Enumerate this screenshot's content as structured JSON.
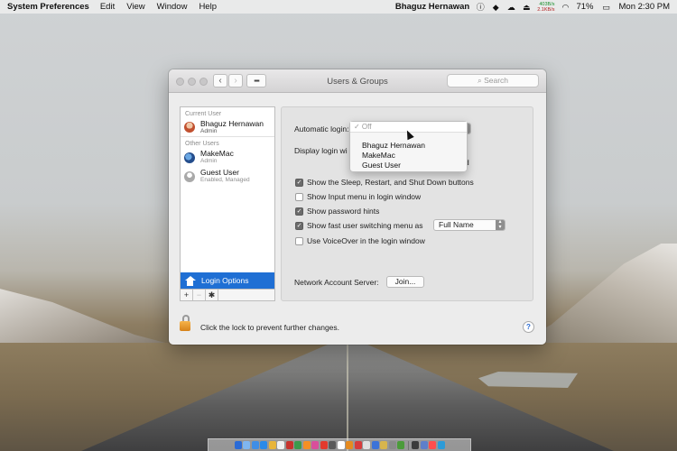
{
  "menubar": {
    "app_name": "System Preferences",
    "items": [
      "Edit",
      "View",
      "Window",
      "Help"
    ],
    "user_name": "Bhaguz Hernawan",
    "net_up": "403B/s",
    "net_down": "2.1KB/s",
    "battery": "71%",
    "clock": "Mon 2:30 PM"
  },
  "window": {
    "title": "Users & Groups",
    "search_placeholder": "Search"
  },
  "sidebar": {
    "current_user_header": "Current User",
    "other_users_header": "Other Users",
    "current_user": {
      "name": "Bhaguz Hernawan",
      "role": "Admin"
    },
    "other_users": [
      {
        "name": "MakeMac",
        "role": "Admin"
      },
      {
        "name": "Guest User",
        "role": "Enabled, Managed"
      }
    ],
    "login_options": "Login Options",
    "add": "+",
    "remove": "−",
    "gear": "✱"
  },
  "panel": {
    "automatic_login_label": "Automatic login:",
    "display_login_label": "Display login wi",
    "display_login_tail": "d",
    "checks": [
      {
        "label": "Show the Sleep, Restart, and Shut Down buttons",
        "checked": true
      },
      {
        "label": "Show Input menu in login window",
        "checked": false
      },
      {
        "label": "Show password hints",
        "checked": true
      },
      {
        "label": "Show fast user switching menu as",
        "checked": true
      },
      {
        "label": "Use VoiceOver in the login window",
        "checked": false
      }
    ],
    "fast_switch_value": "Full Name",
    "network_server_label": "Network Account Server:",
    "join_button": "Join..."
  },
  "popup": {
    "selected": "✓ Off",
    "options": [
      "Bhaguz Hernawan",
      "MakeMac",
      "Guest User"
    ]
  },
  "footer": {
    "lock_text": "Click the lock to prevent further changes.",
    "help": "?"
  },
  "dock_colors": [
    "#2b6bd6",
    "#7fb6f0",
    "#3f8ee6",
    "#2a8ae8",
    "#e8b53a",
    "#f0f0f0",
    "#c7332d",
    "#3b9b4c",
    "#f58f25",
    "#d94e9b",
    "#e23a2c",
    "#5a5a5a",
    "#ffffff",
    "#e68b20",
    "#d63c3c",
    "#e0e0e0",
    "#3c73d8",
    "#d8b54c",
    "#8a8a8a",
    "#4b9b3a",
    "#3b3b3b",
    "#5d7fcb",
    "#ff4d4d",
    "#2d9bd8"
  ]
}
